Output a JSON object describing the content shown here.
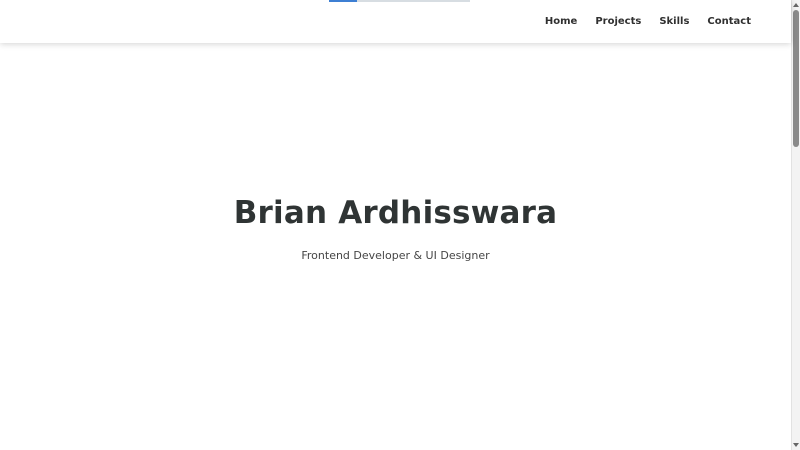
{
  "header": {
    "nav": {
      "home_label": "Home",
      "projects_label": "Projects",
      "skills_label": "Skills",
      "contact_label": "Contact"
    },
    "top_progress": {
      "fill_percent": 20,
      "accent_color": "#3d7fd3"
    }
  },
  "hero": {
    "title": "Brian Ardhisswara",
    "subtitle": "Frontend Developer & UI Designer"
  },
  "scrollbar": {
    "up_icon": "chevron-up-icon",
    "down_icon": "chevron-down-icon"
  }
}
